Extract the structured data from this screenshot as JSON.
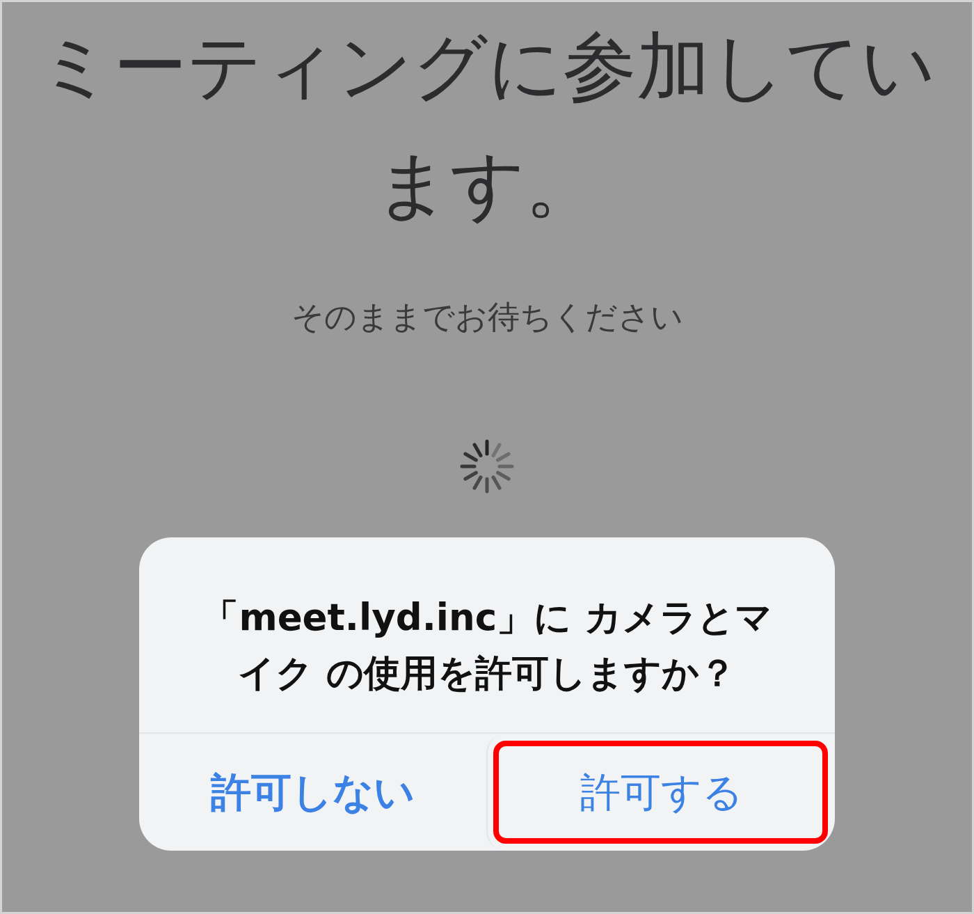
{
  "title": "ミーティングに参加しています。",
  "subtitle": "そのままでお待ちください",
  "loading": true,
  "dialog": {
    "message": "「meet.lyd.inc」に カメラとマイク の使用を許可しますか？",
    "buttons": [
      {
        "label": "許可しない",
        "preferred": true,
        "highlighted": false
      },
      {
        "label": "許可する",
        "preferred": false,
        "highlighted": true
      }
    ]
  }
}
